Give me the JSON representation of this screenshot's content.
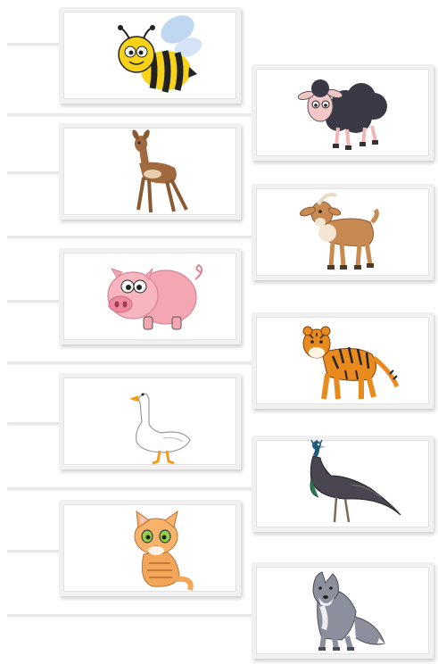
{
  "worksheet": {
    "left_column": [
      {
        "id": "bee",
        "icon": "bee-icon"
      },
      {
        "id": "deer",
        "icon": "deer-icon"
      },
      {
        "id": "pig",
        "icon": "pig-icon"
      },
      {
        "id": "goose",
        "icon": "goose-icon"
      },
      {
        "id": "kitten",
        "icon": "kitten-icon"
      }
    ],
    "right_column": [
      {
        "id": "sheep",
        "icon": "sheep-icon"
      },
      {
        "id": "goat",
        "icon": "goat-icon"
      },
      {
        "id": "tiger",
        "icon": "tiger-icon"
      },
      {
        "id": "peacock",
        "icon": "peacock-icon"
      },
      {
        "id": "wolf",
        "icon": "wolf-icon"
      }
    ],
    "colors": {
      "card_border": "#f1f1f1",
      "guide_line": "#e9e9e9",
      "bee_yellow": "#f7d21b",
      "pig_pink": "#f4a6b3",
      "tiger_orange": "#e98a1f",
      "wolf_gray": "#8d8f9c"
    }
  }
}
